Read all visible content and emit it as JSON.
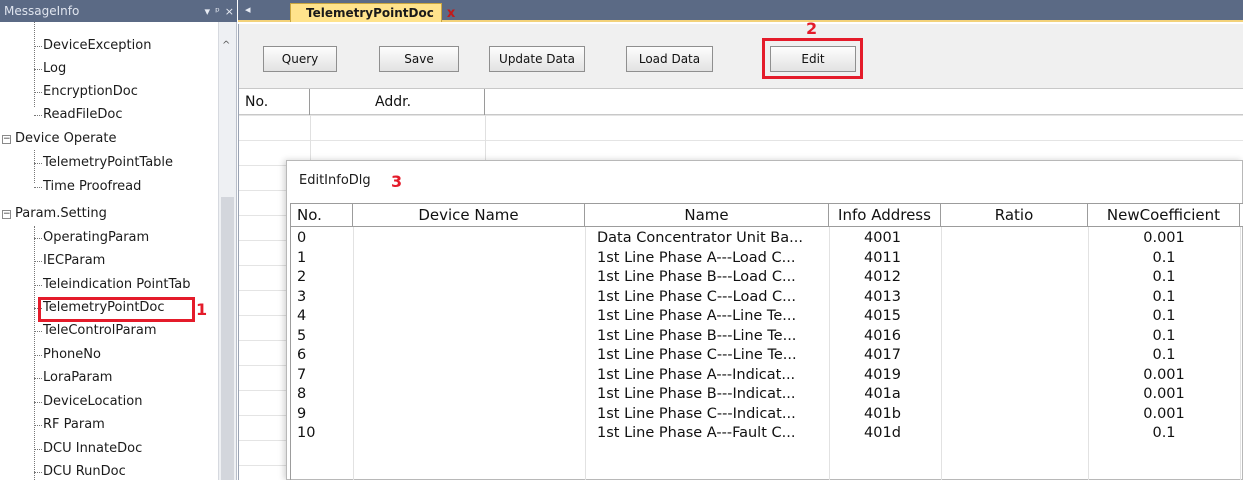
{
  "left_panel": {
    "title": "MessageInfo",
    "controls": [
      "▾",
      "ᵖ",
      "×"
    ],
    "items": {
      "device_exception": "DeviceException",
      "log": "Log",
      "encryption_doc": "EncryptionDoc",
      "read_file_doc": "ReadFileDoc",
      "device_operate": "Device Operate",
      "telemetry_point_table": "TelemetryPointTable",
      "time_proofread": "Time Proofread",
      "param_setting": "Param.Setting",
      "operating_param": "OperatingParam",
      "iec_param": "IECParam",
      "teleindication_point_tab": "Teleindication PointTab",
      "telemetry_point_doc": "TelemetryPointDoc",
      "tele_control_param": "TeleControlParam",
      "phone_no": "PhoneNo",
      "lora_param": "LoraParam",
      "device_location": "DeviceLocation",
      "rf_param": "RF Param",
      "dcu_innate_doc": "DCU InnateDoc",
      "dcu_run_doc": "DCU RunDoc"
    },
    "expander_collapsed": "−",
    "scroll_up": "^"
  },
  "annotations": {
    "one": "1",
    "two": "2",
    "three": "3"
  },
  "tab_bar": {
    "scroll_left": "◂",
    "tab_label": "TelemetryPointDoc",
    "tab_close": "x"
  },
  "toolbar": {
    "query": "Query",
    "save": "Save",
    "update_data": "Update Data",
    "load_data": "Load Data",
    "edit": "Edit"
  },
  "grid": {
    "headers": {
      "no": "No.",
      "addr": "Addr."
    }
  },
  "dialog": {
    "title": "EditInfoDlg",
    "headers": {
      "no": "No.",
      "device_name": "Device Name",
      "name": "Name",
      "info_address": "Info Address",
      "ratio": "Ratio",
      "new_coefficient": "NewCoefficient"
    },
    "rows": [
      {
        "no": "0",
        "name": "Data Concentrator Unit Ba...",
        "addr": "4001",
        "coef": "0.001"
      },
      {
        "no": "1",
        "name": "1st Line Phase A---Load C...",
        "addr": "4011",
        "coef": "0.1"
      },
      {
        "no": "2",
        "name": "1st Line Phase B---Load C...",
        "addr": "4012",
        "coef": "0.1"
      },
      {
        "no": "3",
        "name": "1st Line Phase C---Load C...",
        "addr": "4013",
        "coef": "0.1"
      },
      {
        "no": "4",
        "name": "1st Line Phase A---Line Te...",
        "addr": "4015",
        "coef": "0.1"
      },
      {
        "no": "5",
        "name": "1st Line Phase B---Line Te...",
        "addr": "4016",
        "coef": "0.1"
      },
      {
        "no": "6",
        "name": "1st Line Phase C---Line Te...",
        "addr": "4017",
        "coef": "0.1"
      },
      {
        "no": "7",
        "name": "1st Line Phase A---Indicat...",
        "addr": "4019",
        "coef": "0.001"
      },
      {
        "no": "8",
        "name": "1st Line Phase B---Indicat...",
        "addr": "401a",
        "coef": "0.001"
      },
      {
        "no": "9",
        "name": "1st Line Phase C---Indicat...",
        "addr": "401b",
        "coef": "0.001"
      },
      {
        "no": "10",
        "name": "1st Line Phase A---Fault C...",
        "addr": "401d",
        "coef": "0.1"
      }
    ]
  },
  "colors": {
    "annotation_red": "#e41b2a",
    "panel_header": "#5b6a85",
    "active_tab": "#ffe38c"
  }
}
